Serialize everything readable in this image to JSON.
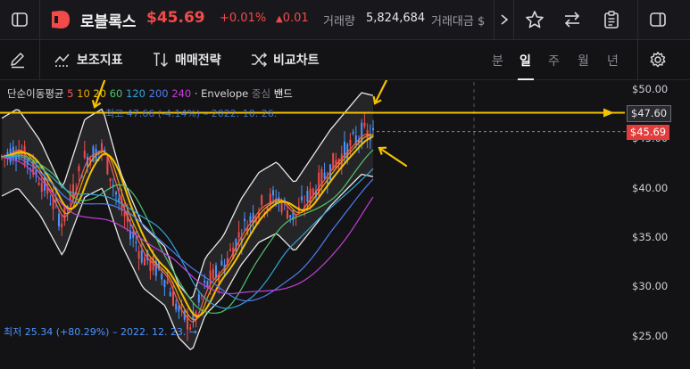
{
  "header": {
    "stock_name": "로블록스",
    "price": "$45.69",
    "change_pct": "+0.01%",
    "change_abs": "0.01",
    "volume_label": "거래량",
    "volume_value": "5,824,684",
    "amount_label": "거래대금 $"
  },
  "toolbar": {
    "indicators_label": "보조지표",
    "strategy_label": "매매전략",
    "compare_label": "비교차트",
    "periods": [
      "분",
      "일",
      "주",
      "월",
      "년"
    ],
    "active_period": "일"
  },
  "legend": {
    "ma_label": "단순이동평균",
    "ma_periods": [
      "5",
      "10",
      "20",
      "60",
      "120",
      "200",
      "240"
    ],
    "ma_colors": [
      "#ff5a5a",
      "#f0a500",
      "#f5c200",
      "#53c36a",
      "#2ea4d6",
      "#4f7df2",
      "#c43fd6"
    ],
    "envelope_label": "· Envelope",
    "envelope_extra": "중심",
    "band_label": "밴드"
  },
  "annotations": {
    "high": "최고 47.66 (-4.14%) – 2022. 10. 26.",
    "low": "최저 25.34 (+80.29%) – 2022. 12. 23. →"
  },
  "price_axis": {
    "ticks": [
      "$50.00",
      "$45.00",
      "$40.00",
      "$35.00",
      "$30.00",
      "$25.00"
    ],
    "tick_values": [
      50,
      45,
      40,
      35,
      30,
      25
    ],
    "marker_price_label": "$47.60",
    "current_price_label": "$45.69",
    "marker_value": 47.6,
    "current_value": 45.69
  },
  "colors": {
    "up": "#f24a4a",
    "down": "#4c93ff",
    "marker_line": "#f5c200",
    "background": "#131316"
  }
}
